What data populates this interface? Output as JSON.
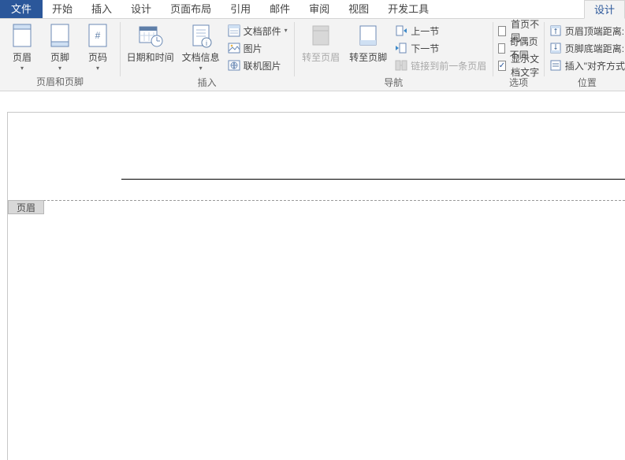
{
  "tabs": {
    "file": "文件",
    "items": [
      "开始",
      "插入",
      "设计",
      "页面布局",
      "引用",
      "邮件",
      "审阅",
      "视图",
      "开发工具"
    ],
    "contextual": "设计"
  },
  "ribbon": {
    "group_hf": {
      "caption": "页眉和页脚",
      "header": "页眉",
      "footer": "页脚",
      "pagenum": "页码"
    },
    "group_insert": {
      "caption": "插入",
      "datetime": "日期和时间",
      "docinfo": "文档信息",
      "docparts": "文档部件",
      "picture": "图片",
      "onlinepic": "联机图片"
    },
    "group_nav": {
      "caption": "导航",
      "goto_header": "转至页眉",
      "goto_footer": "转至页脚",
      "prev": "上一节",
      "next": "下一节",
      "link_prev": "链接到前一条页眉"
    },
    "group_options": {
      "caption": "选项",
      "first_diff": "首页不同",
      "oddeven_diff": "奇偶页不同",
      "show_doc_text": "显示文档文字",
      "show_doc_text_checked": true
    },
    "group_position": {
      "caption": "位置",
      "header_top": "页眉顶端距离:",
      "footer_bottom": "页脚底端距离:",
      "insert_align": "插入\"对齐方式"
    }
  },
  "document": {
    "header_tag": "页眉"
  }
}
